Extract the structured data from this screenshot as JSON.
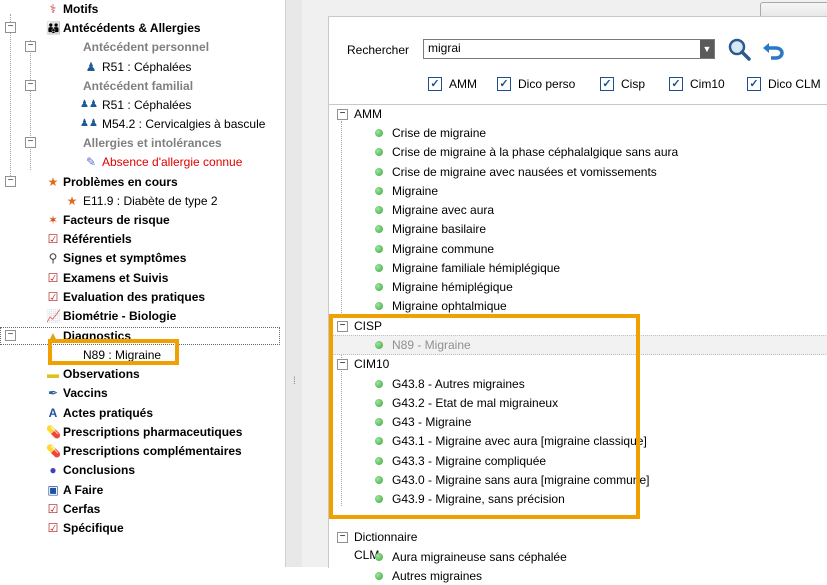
{
  "tree": {
    "motifs": "Motifs",
    "antecedents": "Antécédents & Allergies",
    "ant_personnel": "Antécédent personnel",
    "ant_personnel_item": "R51 : Céphalées",
    "ant_familial": "Antécédent familial",
    "ant_familial_items": [
      "R51 : Céphalées",
      "M54.2 : Cervicalgies à bascule"
    ],
    "allergies": "Allergies et intolérances",
    "allergies_item": "Absence d'allergie connue",
    "problemes": "Problèmes en cours",
    "problemes_item": "E11.9 : Diabète de type 2",
    "facteurs": "Facteurs de risque",
    "referentiels": "Référentiels",
    "signes": "Signes et symptômes",
    "examens": "Examens et Suivis",
    "evaluation": "Evaluation des pratiques",
    "biometrie": "Biométrie - Biologie",
    "diagnostics": "Diagnostics",
    "diagnostics_item": "N89 : Migraine",
    "observations": "Observations",
    "vaccins": "Vaccins",
    "actes": "Actes pratiqués",
    "prescriptions_pharma": "Prescriptions pharmaceutiques",
    "prescriptions_comp": "Prescriptions complémentaires",
    "conclusions": "Conclusions",
    "a_faire": "A Faire",
    "cerfas": "Cerfas",
    "specifique": "Spécifique"
  },
  "search": {
    "label": "Rechercher",
    "value": "migrai"
  },
  "filters": [
    "AMM",
    "Dico perso",
    "Cisp",
    "Cim10",
    "Dico CLM"
  ],
  "results": {
    "amm": {
      "title": "AMM",
      "items": [
        "Crise de migraine",
        "Crise de migraine à la phase céphalalgique sans aura",
        "Crise de migraine avec nausées et vomissements",
        "Migraine",
        "Migraine avec aura",
        "Migraine basilaire",
        "Migraine commune",
        "Migraine familiale hémiplégique",
        "Migraine hémiplégique",
        "Migraine ophtalmique"
      ]
    },
    "cisp": {
      "title": "CISP",
      "items": [
        "N89 - Migraine"
      ]
    },
    "cim10": {
      "title": "CIM10",
      "items": [
        "G43.8 - Autres migraines",
        "G43.2 - Etat de mal migraineux",
        "G43 - Migraine",
        "G43.1 - Migraine avec aura [migraine classique]",
        "G43.3 - Migraine compliquée",
        "G43.0 - Migraine sans aura [migraine commune]",
        "G43.9 - Migraine, sans précision"
      ]
    },
    "clm": {
      "title": "Dictionnaire CLM",
      "items": [
        "Aura migraineuse sans céphalée",
        "Autres migraines"
      ]
    }
  },
  "colors": {
    "highlight": "#f0a000",
    "check": "#1c4f8c",
    "dot": "#3aa83a",
    "allergy_red": "#e00000"
  }
}
